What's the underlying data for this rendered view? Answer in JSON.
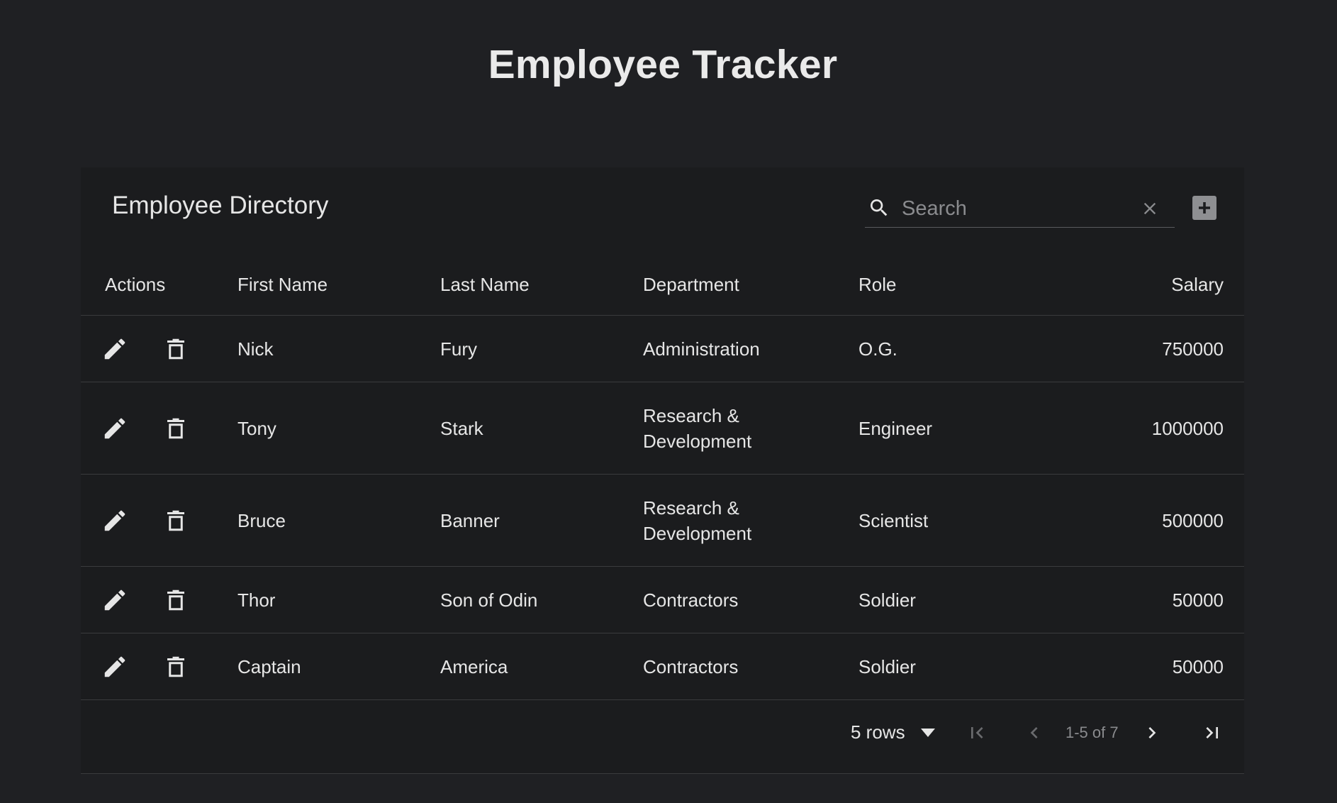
{
  "app": {
    "title": "Employee Tracker"
  },
  "directory": {
    "title": "Employee Directory",
    "search": {
      "placeholder": "Search",
      "value": ""
    },
    "icons": {
      "search": "search-icon",
      "clear": "close-icon",
      "add": "add-box-icon"
    }
  },
  "table": {
    "columns": {
      "actions": "Actions",
      "first_name": "First Name",
      "last_name": "Last Name",
      "department": "Department",
      "role": "Role",
      "salary": "Salary"
    },
    "rows": [
      {
        "first_name": "Nick",
        "last_name": "Fury",
        "department": "Administration",
        "role": "O.G.",
        "salary": "750000"
      },
      {
        "first_name": "Tony",
        "last_name": "Stark",
        "department": "Research & Development",
        "role": "Engineer",
        "salary": "1000000"
      },
      {
        "first_name": "Bruce",
        "last_name": "Banner",
        "department": "Research & Development",
        "role": "Scientist",
        "salary": "500000"
      },
      {
        "first_name": "Thor",
        "last_name": "Son of Odin",
        "department": "Contractors",
        "role": "Soldier",
        "salary": "50000"
      },
      {
        "first_name": "Captain",
        "last_name": "America",
        "department": "Contractors",
        "role": "Soldier",
        "salary": "50000"
      }
    ],
    "row_icons": {
      "edit": "pencil-icon",
      "delete": "trash-icon"
    }
  },
  "pagination": {
    "rows_per_page": "5 rows",
    "range": "1-5 of 7",
    "icons": {
      "first": "first-page-icon",
      "prev": "chevron-left-icon",
      "next": "chevron-right-icon",
      "last": "last-page-icon"
    }
  },
  "colors": {
    "background": "#1f2023",
    "card": "#1b1c1e",
    "text": "#e6e6e6",
    "muted": "#8a8b8e",
    "divider": "#3a3b3d"
  }
}
